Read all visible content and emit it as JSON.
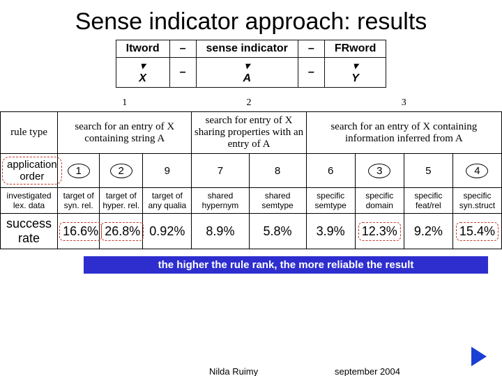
{
  "title": "Sense indicator approach: results",
  "mapping": {
    "row1": {
      "c1": "Itword",
      "c2": "–",
      "c3": "sense indicator",
      "c4": "–",
      "c5": "FRword"
    },
    "row2": {
      "c1": "X",
      "c2": "–",
      "c3": "A",
      "c4": "–",
      "c5": "Y"
    }
  },
  "table": {
    "rowLabels": {
      "rule": "rule type",
      "app": "application order",
      "lex": "investigated lex. data",
      "succ": "success rate"
    },
    "groupHeads": {
      "g1": "1",
      "g2": "2",
      "g3": "3"
    },
    "ruleText": {
      "g1": "search for an entry of X containing string A",
      "g2": "search for entry of X sharing properties with an entry of A",
      "g3": "search for an entry of X containing information inferred from A"
    },
    "order": [
      "1",
      "2",
      "9",
      "7",
      "8",
      "6",
      "3",
      "5",
      "4"
    ],
    "lex": [
      "target of syn. rel.",
      "target of hyper. rel.",
      "target of any qualia",
      "shared hypernym",
      "shared semtype",
      "specific semtype",
      "specific domain",
      "specific feat/rel",
      "specific syn.struct"
    ],
    "succ": [
      "16.6%",
      "26.8%",
      "0.92%",
      "8.9%",
      "5.8%",
      "3.9%",
      "12.3%",
      "9.2%",
      "15.4%"
    ]
  },
  "banner": "the higher the rule rank, the more reliable the result",
  "footer": {
    "author": "Nilda Ruimy",
    "date": "september 2004"
  }
}
